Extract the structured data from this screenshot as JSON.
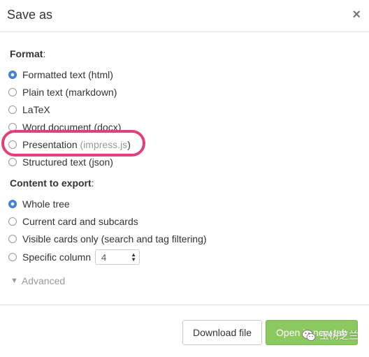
{
  "dialog": {
    "title": "Save as",
    "close_glyph": "×"
  },
  "format": {
    "label": "Format",
    "label_suffix": ":",
    "options": [
      {
        "label": "Formatted text (html)",
        "checked": true
      },
      {
        "label": "Plain text (markdown)",
        "checked": false
      },
      {
        "label": "LaTeX",
        "checked": false
      },
      {
        "label": "Word document (docx)",
        "checked": false
      },
      {
        "label": "Presentation",
        "hint": "impress.js",
        "checked": false,
        "highlighted": true
      },
      {
        "label": "Structured text (json)",
        "checked": false
      }
    ]
  },
  "content": {
    "label": "Content to export",
    "label_suffix": ":",
    "options": [
      {
        "label": "Whole tree",
        "checked": true
      },
      {
        "label": "Current card and subcards",
        "checked": false
      },
      {
        "label": "Visible cards only (search and tag filtering)",
        "checked": false
      },
      {
        "label": "Specific column",
        "checked": false
      }
    ],
    "column_select": {
      "value": "4"
    }
  },
  "advanced": {
    "label": "Advanced",
    "icon": "triangle-down-icon"
  },
  "footer": {
    "download_label": "Download file",
    "open_tab_label": "Open in new tab"
  },
  "watermark": {
    "text": "玉树芝兰",
    "icon": "wechat-icon"
  },
  "colors": {
    "accent_radio": "#4a86d4",
    "highlight_ring": "#e0407b",
    "primary_button": "#8cc860"
  }
}
